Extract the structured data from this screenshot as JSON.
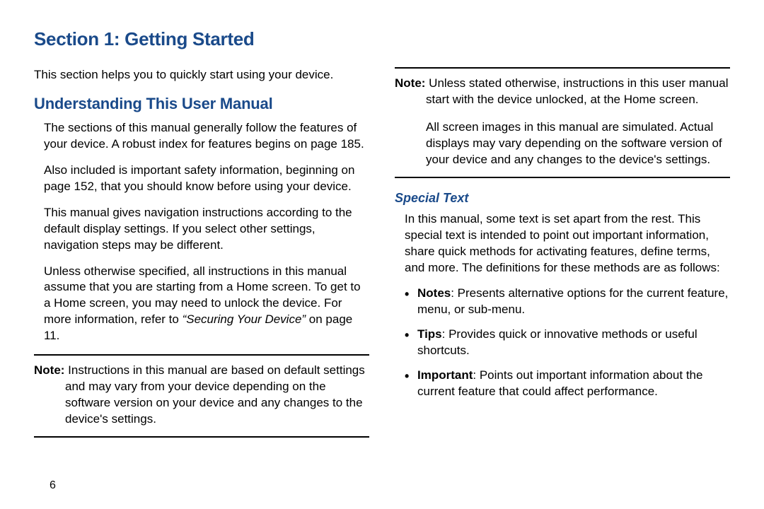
{
  "section_title": "Section 1: Getting Started",
  "left": {
    "intro": "This section helps you to quickly start using your device.",
    "h2": "Understanding This User Manual",
    "p1": "The sections of this manual generally follow the features of your device. A robust index for features begins on page 185.",
    "p2": "Also included is important safety information, beginning on page 152, that you should know before using your device.",
    "p3": "This manual gives navigation instructions according to the default display settings. If you select other settings, navigation steps may be different.",
    "p4_a": "Unless otherwise specified, all instructions in this manual assume that you are starting from a Home screen. To get to a Home screen, you may need to unlock the device. For more information, refer to ",
    "p4_ref": "“Securing Your Device”",
    "p4_b": " on page 11.",
    "note1_label": "Note: ",
    "note1_body": "Instructions in this manual are based on default settings and may vary from your device depending on the software version on your device and any changes to the device's settings."
  },
  "right": {
    "note2_label": "Note: ",
    "note2_body": "Unless stated otherwise, instructions in this user manual start with the device unlocked, at the Home screen.",
    "note2_para2": "All screen images in this manual are simulated. Actual displays may vary depending on the software version of your device and any changes to the device's settings.",
    "h3": "Special Text",
    "p1": "In this manual, some text is set apart from the rest. This special text is intended to point out important information, share quick methods for activating features, define terms, and more. The definitions for these methods are as follows:",
    "bullets": [
      {
        "term": "Notes",
        "def": ": Presents alternative options for the current feature, menu, or sub-menu."
      },
      {
        "term": "Tips",
        "def": ": Provides quick or innovative methods or useful shortcuts."
      },
      {
        "term": "Important",
        "def": ": Points out important information about the current feature that could affect performance."
      }
    ]
  },
  "page_number": "6"
}
